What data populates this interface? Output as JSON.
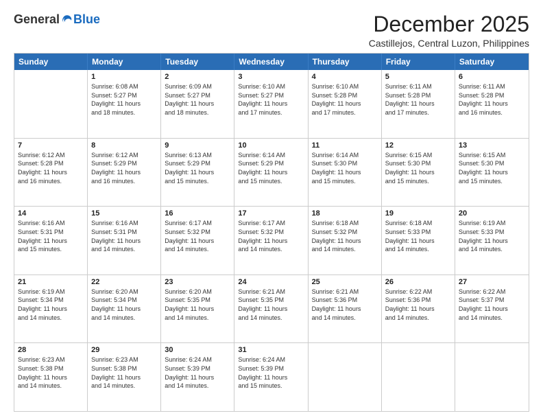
{
  "logo": {
    "general": "General",
    "blue": "Blue"
  },
  "title": "December 2025",
  "location": "Castillejos, Central Luzon, Philippines",
  "header": {
    "days": [
      "Sunday",
      "Monday",
      "Tuesday",
      "Wednesday",
      "Thursday",
      "Friday",
      "Saturday"
    ]
  },
  "weeks": [
    [
      {
        "day": "",
        "info": ""
      },
      {
        "day": "1",
        "info": "Sunrise: 6:08 AM\nSunset: 5:27 PM\nDaylight: 11 hours\nand 18 minutes."
      },
      {
        "day": "2",
        "info": "Sunrise: 6:09 AM\nSunset: 5:27 PM\nDaylight: 11 hours\nand 18 minutes."
      },
      {
        "day": "3",
        "info": "Sunrise: 6:10 AM\nSunset: 5:27 PM\nDaylight: 11 hours\nand 17 minutes."
      },
      {
        "day": "4",
        "info": "Sunrise: 6:10 AM\nSunset: 5:28 PM\nDaylight: 11 hours\nand 17 minutes."
      },
      {
        "day": "5",
        "info": "Sunrise: 6:11 AM\nSunset: 5:28 PM\nDaylight: 11 hours\nand 17 minutes."
      },
      {
        "day": "6",
        "info": "Sunrise: 6:11 AM\nSunset: 5:28 PM\nDaylight: 11 hours\nand 16 minutes."
      }
    ],
    [
      {
        "day": "7",
        "info": "Sunrise: 6:12 AM\nSunset: 5:28 PM\nDaylight: 11 hours\nand 16 minutes."
      },
      {
        "day": "8",
        "info": "Sunrise: 6:12 AM\nSunset: 5:29 PM\nDaylight: 11 hours\nand 16 minutes."
      },
      {
        "day": "9",
        "info": "Sunrise: 6:13 AM\nSunset: 5:29 PM\nDaylight: 11 hours\nand 15 minutes."
      },
      {
        "day": "10",
        "info": "Sunrise: 6:14 AM\nSunset: 5:29 PM\nDaylight: 11 hours\nand 15 minutes."
      },
      {
        "day": "11",
        "info": "Sunrise: 6:14 AM\nSunset: 5:30 PM\nDaylight: 11 hours\nand 15 minutes."
      },
      {
        "day": "12",
        "info": "Sunrise: 6:15 AM\nSunset: 5:30 PM\nDaylight: 11 hours\nand 15 minutes."
      },
      {
        "day": "13",
        "info": "Sunrise: 6:15 AM\nSunset: 5:30 PM\nDaylight: 11 hours\nand 15 minutes."
      }
    ],
    [
      {
        "day": "14",
        "info": "Sunrise: 6:16 AM\nSunset: 5:31 PM\nDaylight: 11 hours\nand 15 minutes."
      },
      {
        "day": "15",
        "info": "Sunrise: 6:16 AM\nSunset: 5:31 PM\nDaylight: 11 hours\nand 14 minutes."
      },
      {
        "day": "16",
        "info": "Sunrise: 6:17 AM\nSunset: 5:32 PM\nDaylight: 11 hours\nand 14 minutes."
      },
      {
        "day": "17",
        "info": "Sunrise: 6:17 AM\nSunset: 5:32 PM\nDaylight: 11 hours\nand 14 minutes."
      },
      {
        "day": "18",
        "info": "Sunrise: 6:18 AM\nSunset: 5:32 PM\nDaylight: 11 hours\nand 14 minutes."
      },
      {
        "day": "19",
        "info": "Sunrise: 6:18 AM\nSunset: 5:33 PM\nDaylight: 11 hours\nand 14 minutes."
      },
      {
        "day": "20",
        "info": "Sunrise: 6:19 AM\nSunset: 5:33 PM\nDaylight: 11 hours\nand 14 minutes."
      }
    ],
    [
      {
        "day": "21",
        "info": "Sunrise: 6:19 AM\nSunset: 5:34 PM\nDaylight: 11 hours\nand 14 minutes."
      },
      {
        "day": "22",
        "info": "Sunrise: 6:20 AM\nSunset: 5:34 PM\nDaylight: 11 hours\nand 14 minutes."
      },
      {
        "day": "23",
        "info": "Sunrise: 6:20 AM\nSunset: 5:35 PM\nDaylight: 11 hours\nand 14 minutes."
      },
      {
        "day": "24",
        "info": "Sunrise: 6:21 AM\nSunset: 5:35 PM\nDaylight: 11 hours\nand 14 minutes."
      },
      {
        "day": "25",
        "info": "Sunrise: 6:21 AM\nSunset: 5:36 PM\nDaylight: 11 hours\nand 14 minutes."
      },
      {
        "day": "26",
        "info": "Sunrise: 6:22 AM\nSunset: 5:36 PM\nDaylight: 11 hours\nand 14 minutes."
      },
      {
        "day": "27",
        "info": "Sunrise: 6:22 AM\nSunset: 5:37 PM\nDaylight: 11 hours\nand 14 minutes."
      }
    ],
    [
      {
        "day": "28",
        "info": "Sunrise: 6:23 AM\nSunset: 5:38 PM\nDaylight: 11 hours\nand 14 minutes."
      },
      {
        "day": "29",
        "info": "Sunrise: 6:23 AM\nSunset: 5:38 PM\nDaylight: 11 hours\nand 14 minutes."
      },
      {
        "day": "30",
        "info": "Sunrise: 6:24 AM\nSunset: 5:39 PM\nDaylight: 11 hours\nand 14 minutes."
      },
      {
        "day": "31",
        "info": "Sunrise: 6:24 AM\nSunset: 5:39 PM\nDaylight: 11 hours\nand 15 minutes."
      },
      {
        "day": "",
        "info": ""
      },
      {
        "day": "",
        "info": ""
      },
      {
        "day": "",
        "info": ""
      }
    ]
  ]
}
